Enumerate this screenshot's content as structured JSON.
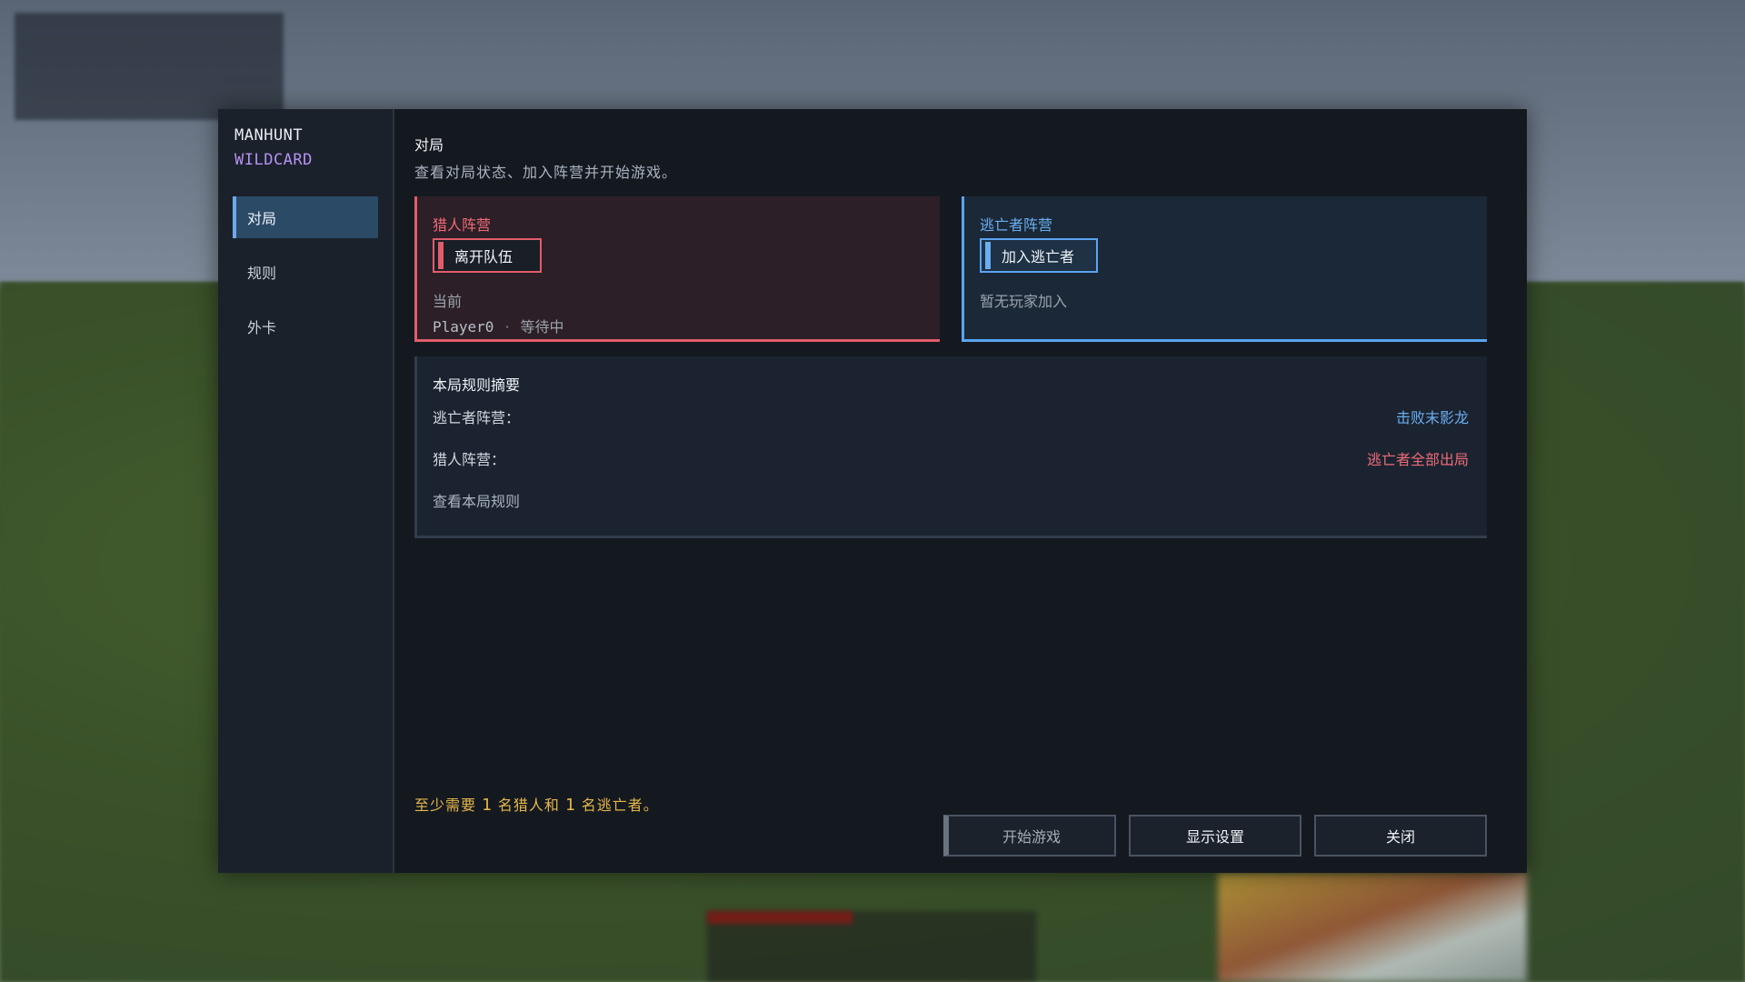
{
  "brand": {
    "line1": "MANHUNT",
    "line2": "WILDCARD"
  },
  "nav": {
    "items": [
      {
        "label": "对局"
      },
      {
        "label": "规则"
      },
      {
        "label": "外卡"
      }
    ],
    "active": "对局"
  },
  "page": {
    "title": "对局",
    "subtitle": "查看对局状态、加入阵营并开始游戏。"
  },
  "teams": {
    "hunter": {
      "name": "猎人阵营",
      "button_label": "离开队伍",
      "current_label": "当前",
      "player": {
        "name": "Player0",
        "separator": "·",
        "status": "等待中"
      }
    },
    "runner": {
      "name": "逃亡者阵营",
      "button_label": "加入逃亡者",
      "empty_text": "暂无玩家加入"
    }
  },
  "rules_summary": {
    "title": "本局规则摘要",
    "rows": [
      {
        "key": "逃亡者阵营：",
        "value": "击败末影龙"
      },
      {
        "key": "猎人阵营：",
        "value": "逃亡者全部出局"
      }
    ],
    "link": "查看本局规则"
  },
  "notice": {
    "p1": "至少需要",
    "hunters": "1",
    "p2": "名猎人和",
    "runners": "1",
    "p3": "名逃亡者。"
  },
  "footer": {
    "start_label": "开始游戏",
    "display_label": "显示设置",
    "close_label": "关闭"
  },
  "colors": {
    "hunter": "#e25c6a",
    "runner": "#5aa4f0",
    "accent": "#b691f5",
    "warning": "#e7b64a"
  }
}
